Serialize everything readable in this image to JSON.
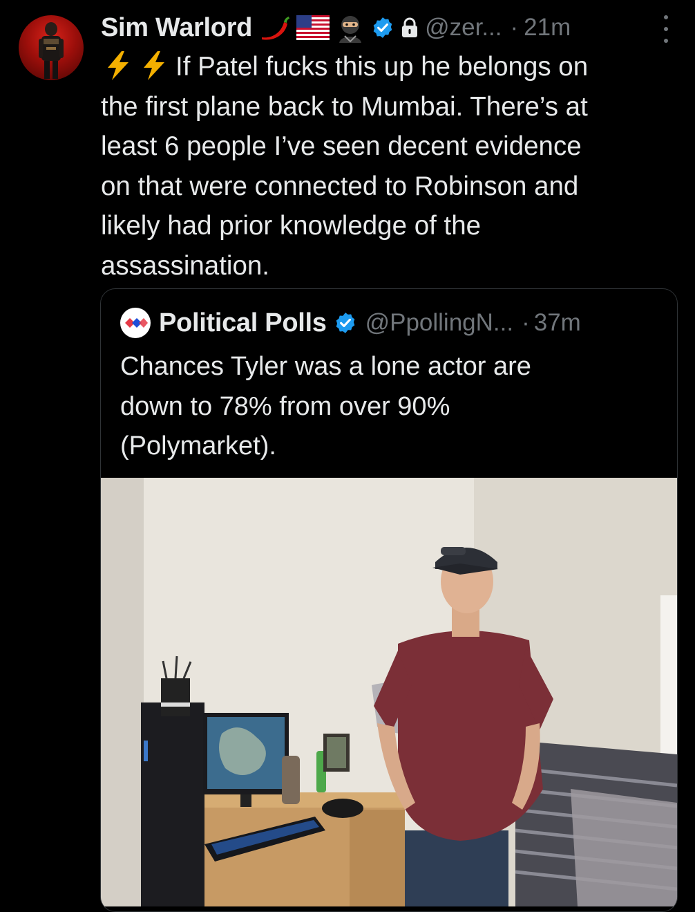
{
  "author": {
    "name": "Sim Warlord",
    "handle": "@zer...",
    "time": "21m",
    "badges": [
      "chili-pepper-emoji",
      "us-flag-emoji",
      "ninja-emoji",
      "verified-badge-icon",
      "lock-icon"
    ],
    "verified_color": "#1d9bf0"
  },
  "post": {
    "leading_icons": [
      "lightning-icon",
      "lightning-icon"
    ],
    "text": "If Patel fucks this up he belongs on\nthe first plane back to Mumbai. There’s at\nleast 6 people I’ve seen decent evidence\non that were connected to Robinson and\nlikely had prior knowledge of the\nassassination."
  },
  "quoted_post": {
    "name": "Political Polls",
    "handle": "@PpollingN...",
    "time": "37m",
    "text": "Chances Tyler was a lone actor are\ndown to 78% from over 90%\n(Polymarket).",
    "image_icon": "dorm-room-photo"
  },
  "ui": {
    "separator": "·",
    "more_icon": "more-vertical-icon"
  },
  "colors": {
    "background": "#000000",
    "text": "#e7e9ea",
    "secondary_text": "#71767b",
    "border": "#2f3336",
    "accent": "#1d9bf0"
  }
}
